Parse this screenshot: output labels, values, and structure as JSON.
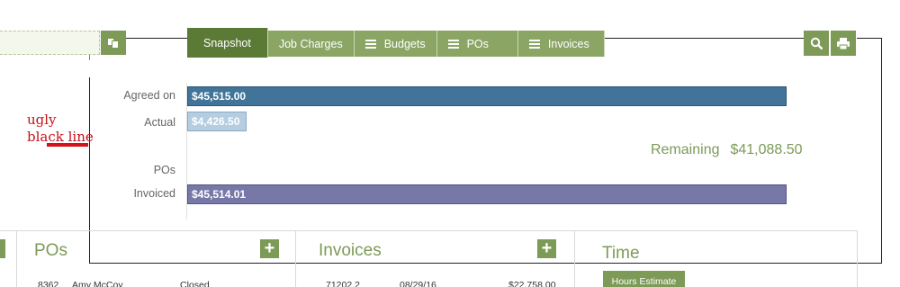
{
  "tabs": [
    {
      "label": "Snapshot",
      "icon": "",
      "active": true
    },
    {
      "label": "Job Charges",
      "icon": ""
    },
    {
      "label": "Budgets",
      "icon": "list-icon"
    },
    {
      "label": "POs",
      "icon": "list-icon"
    },
    {
      "label": "Invoices",
      "icon": "list-icon"
    }
  ],
  "tools": {
    "search_icon": "search-icon",
    "print_icon": "print-icon"
  },
  "snapshot": {
    "labels": {
      "agreed": "Agreed on",
      "actual": "Actual",
      "pos": "POs",
      "invoiced": "Invoiced"
    },
    "bars": {
      "agreed": "$45,515.00",
      "actual": "$4,426.50",
      "invoiced": "$45,514.01"
    },
    "remaining_label": "Remaining",
    "remaining_value": "$41,088.50"
  },
  "chart_data": {
    "type": "bar",
    "categories": [
      "Agreed on",
      "Actual",
      "POs",
      "Invoiced"
    ],
    "values": [
      45515.0,
      4426.5,
      0,
      45514.01
    ]
  },
  "annotation": {
    "line1": "ugly",
    "line2": "black line"
  },
  "panels": {
    "pos": {
      "title": "POs",
      "row": [
        "8362",
        "Amy McCoy",
        "Closed"
      ]
    },
    "invoices": {
      "title": "Invoices",
      "row": [
        "71202.2",
        "08/29/16",
        "$22,758.00"
      ]
    },
    "time": {
      "title": "Time",
      "button": "Hours Estimate"
    }
  },
  "colors": {
    "accent": "#7d9a57",
    "agreed": "#42749a",
    "actual": "#b5cde0",
    "invoiced": "#7878a8",
    "annotation": "#c8101a"
  }
}
